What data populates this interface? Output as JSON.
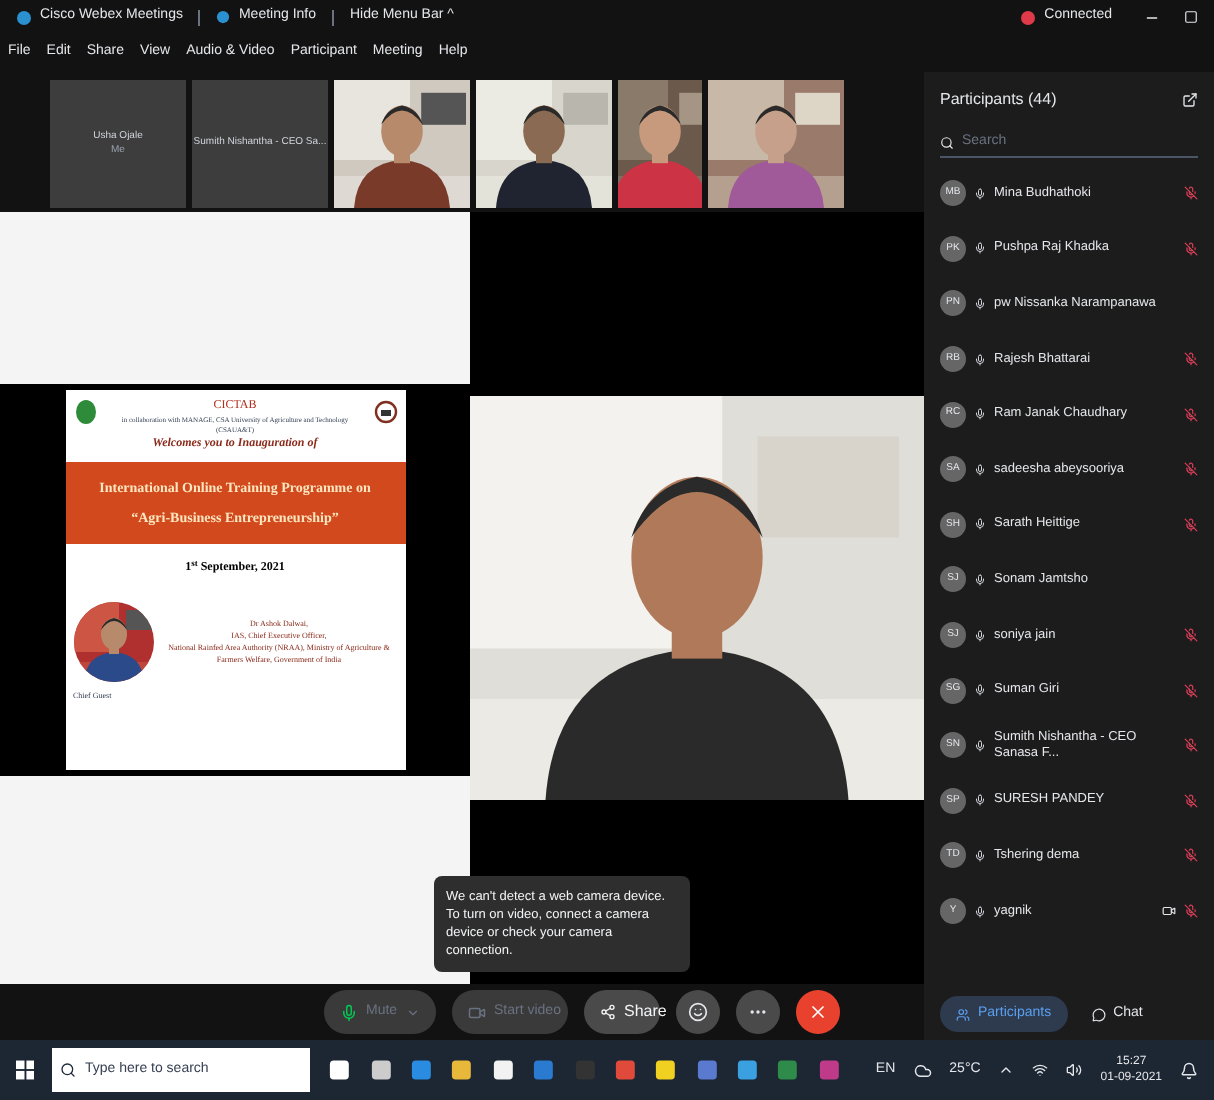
{
  "title_bar": {
    "app": "Cisco Webex Meetings",
    "meeting_info": "Meeting Info",
    "hide_menu": "Hide Menu Bar ^",
    "status": "Connected"
  },
  "menu": [
    "File",
    "Edit",
    "Share",
    "View",
    "Audio & Video",
    "Participant",
    "Meeting",
    "Help"
  ],
  "thumbnails": [
    {
      "kind": "name",
      "name": "Usha Ojale",
      "sub": "Me"
    },
    {
      "kind": "name",
      "name": "Sumith Nishantha - CEO Sa..."
    },
    {
      "kind": "picture"
    },
    {
      "kind": "picture"
    },
    {
      "kind": "picture"
    },
    {
      "kind": "picture"
    }
  ],
  "slide": {
    "org": "CICTAB",
    "collab": "in collaboration with MANAGE, CSA University of Agriculture and Technology (CSAUA&T)",
    "welcome": "Welcomes you to Inauguration of",
    "banner_1": "International Online Training Programme on",
    "banner_2": "“Agri-Business Entrepreneurship”",
    "date": "1$^{st}$ September, 2021",
    "guest_name": "Dr Ashok Dalwai,",
    "guest_role": "IAS, Chief Executive Officer,",
    "guest_org": "National Rainfed Area Authority (NRAA), Ministry of Agriculture & Farmers Welfare, Government of India",
    "guest_label": "Chief Guest"
  },
  "tooltip": "We can't detect a web camera device. To turn on video, connect a camera device or check your camera connection.",
  "controls": [
    {
      "kind": "mute",
      "label": "Mute",
      "disabled": true
    },
    {
      "kind": "video",
      "label": "Start video",
      "disabled": true
    },
    {
      "kind": "share",
      "label": "Share",
      "disabled": false
    },
    {
      "kind": "reactions"
    },
    {
      "kind": "more"
    },
    {
      "kind": "end"
    }
  ],
  "participants": {
    "title": "Participants (44)",
    "search": {
      "placeholder": "Search"
    },
    "items": [
      {
        "initials": "MB",
        "name": "Mina Budhathoki",
        "muted": true
      },
      {
        "initials": "PK",
        "name": "Pushpa Raj Khadka",
        "muted": true
      },
      {
        "initials": "PN",
        "name": "pw Nissanka Narampanawa",
        "muted": false
      },
      {
        "initials": "RB",
        "name": "Rajesh Bhattarai",
        "muted": true
      },
      {
        "initials": "RC",
        "name": "Ram Janak Chaudhary",
        "muted": true
      },
      {
        "initials": "SA",
        "name": "sadeesha abeysooriya",
        "muted": true
      },
      {
        "initials": "SH",
        "name": "Sarath Heittige",
        "muted": true
      },
      {
        "initials": "SJ",
        "name": "Sonam Jamtsho",
        "muted": false
      },
      {
        "initials": "SJ",
        "name": "soniya jain",
        "muted": true
      },
      {
        "initials": "SG",
        "name": "Suman Giri",
        "muted": true
      },
      {
        "initials": "SN",
        "name": "Sumith Nishantha - CEO Sanasa F...",
        "muted": true
      },
      {
        "initials": "SP",
        "name": "SURESH PANDEY",
        "muted": true
      },
      {
        "initials": "TD",
        "name": "Tshering dema",
        "muted": true
      },
      {
        "initials": "Y",
        "name": "yagnik",
        "muted": true,
        "camera": true
      }
    ],
    "tabs": [
      {
        "label": "Participants",
        "selected": true
      },
      {
        "label": "Chat",
        "selected": false
      }
    ]
  },
  "taskbar": {
    "search": {
      "placeholder": "Type here to search"
    },
    "language": "EN",
    "weather": "25°C",
    "time": "15:27",
    "date": "01-09-2021"
  }
}
